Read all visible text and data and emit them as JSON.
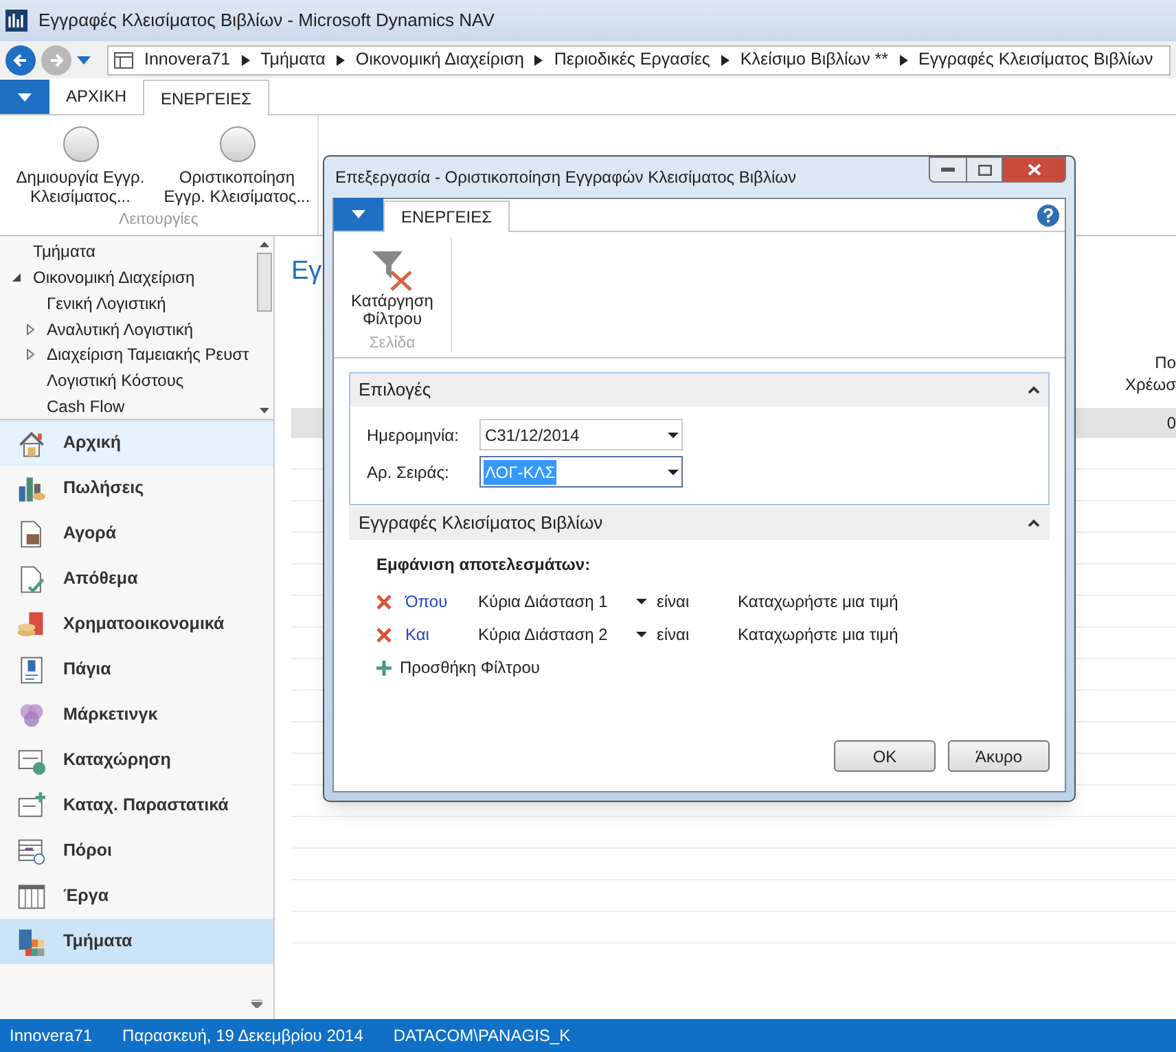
{
  "window": {
    "title": "Εγγραφές Κλεισίματος Βιβλίων - Microsoft Dynamics NAV"
  },
  "address_bar": {
    "crumbs": [
      "Innovera71",
      "Τμήματα",
      "Οικονομική Διαχείριση",
      "Περιοδικές Εργασίες",
      "Κλείσιμο Βιβλίων **",
      "Εγγραφές Κλεισίματος Βιβλίων"
    ]
  },
  "ribbon": {
    "tabs": [
      {
        "label": "ΑΡΧΙΚΗ",
        "selected": false
      },
      {
        "label": "ΕΝΕΡΓΕΙΕΣ",
        "selected": true
      }
    ],
    "actions": [
      {
        "label": "Δημιουργία Εγγρ. Κλεισίματος..."
      },
      {
        "label": "Οριστικοποίηση Εγγρ. Κλεισίματος..."
      }
    ],
    "group_label": "Λειτουργίες"
  },
  "nav": {
    "tree": [
      {
        "label": "Τμήματα"
      },
      {
        "label": "Οικονομική Διαχείριση",
        "expanded": true,
        "children": [
          {
            "label": "Γενική Λογιστική"
          },
          {
            "label": "Αναλυτική Λογιστική",
            "expanded": false
          },
          {
            "label": "Διαχείριση Ταμειακής Ρευστ",
            "expanded": false
          },
          {
            "label": "Λογιστική Κόστους"
          },
          {
            "label": "Cash Flow"
          }
        ]
      }
    ],
    "sections": [
      {
        "label": "Αρχική",
        "selected": false,
        "hovered": true
      },
      {
        "label": "Πωλήσεις",
        "selected": false,
        "hovered": false
      },
      {
        "label": "Αγορά",
        "selected": false,
        "hovered": false
      },
      {
        "label": "Απόθεμα",
        "selected": false,
        "hovered": false
      },
      {
        "label": "Χρηματοοικονομικά",
        "selected": false,
        "hovered": false
      },
      {
        "label": "Πάγια",
        "selected": false,
        "hovered": false
      },
      {
        "label": "Μάρκετινγκ",
        "selected": false,
        "hovered": false
      },
      {
        "label": "Καταχώρηση",
        "selected": false,
        "hovered": false
      },
      {
        "label": "Καταχ. Παραστατικά",
        "selected": false,
        "hovered": false
      },
      {
        "label": "Πόροι",
        "selected": false,
        "hovered": false
      },
      {
        "label": "Έργα",
        "selected": false,
        "hovered": false
      },
      {
        "label": "Τμήματα",
        "selected": true,
        "hovered": false
      }
    ]
  },
  "page": {
    "title": "Εγ",
    "column_header": [
      "Πο",
      "Χρέωσ"
    ],
    "cell": "0"
  },
  "dialog": {
    "title": "Επεξεργασία - Οριστικοποίηση Εγγραφών Κλεισίματος Βιβλίων",
    "tabs": [
      {
        "label": "ΕΝΕΡΓΕΙΕΣ",
        "selected": true
      }
    ],
    "action": {
      "label": "Κατάργηση Φίλτρου"
    },
    "group_label": "Σελίδα",
    "options": {
      "title": "Επιλογές",
      "expanded": true,
      "fields": [
        {
          "label": "Ημερομηνία:",
          "value": "C31/12/2014",
          "focused": false
        },
        {
          "label": "Αρ. Σειράς:",
          "value": "ΛΟΓ-ΚΛΣ",
          "focused": true
        }
      ]
    },
    "filters": {
      "title": "Εγγραφές Κλεισίματος Βιβλίων",
      "expanded": true,
      "heading": "Εμφάνιση αποτελεσμάτων:",
      "rows": [
        {
          "connector": "Όπου",
          "field": "Κύρια Διάσταση 1",
          "operator": "είναι",
          "value": "Καταχωρήστε μια τιμή"
        },
        {
          "connector": "Και",
          "field": "Κύρια Διάσταση 2",
          "operator": "είναι",
          "value": "Καταχωρήστε μια τιμή"
        }
      ],
      "add_label": "Προσθήκη Φίλτρου"
    },
    "buttons": [
      "OK",
      "Άκυρο"
    ]
  },
  "status_bar": [
    "Innovera71",
    "Παρασκευή, 19 Δεκεμβρίου 2014",
    "DATACOM\\PANAGIS_K"
  ]
}
